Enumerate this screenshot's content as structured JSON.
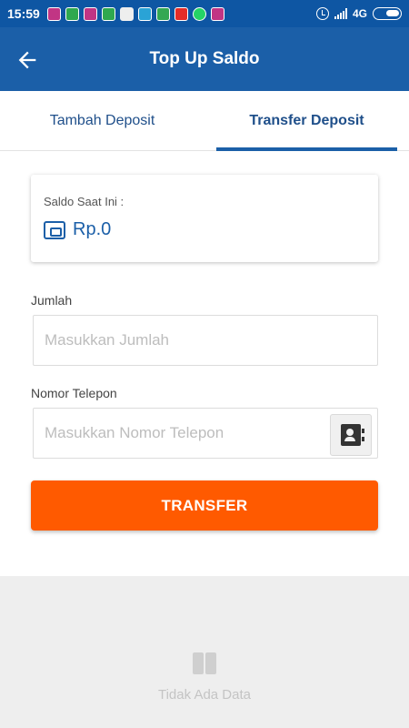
{
  "status_bar": {
    "time": "15:59",
    "network": "4G",
    "notification_icons": [
      "instagram-icon",
      "messenger-icon",
      "instagram-icon",
      "messages-icon",
      "chrome-icon",
      "telegram-icon",
      "maps-icon",
      "youtube-icon",
      "whatsapp-icon",
      "instagram-icon"
    ]
  },
  "app_bar": {
    "title": "Top Up Saldo",
    "back_icon": "arrow-left-icon"
  },
  "tabs": [
    {
      "label": "Tambah Deposit",
      "active": false
    },
    {
      "label": "Transfer Deposit",
      "active": true
    }
  ],
  "balance": {
    "label": "Saldo Saat Ini :",
    "value": "Rp.0",
    "icon": "wallet-icon"
  },
  "form": {
    "amount_label": "Jumlah",
    "amount_placeholder": "Masukkan Jumlah",
    "amount_value": "",
    "phone_label": "Nomor Telepon",
    "phone_placeholder": "Masukkan Nomor Telepon",
    "phone_value": "",
    "contact_icon": "contact-book-icon",
    "submit_label": "TRANSFER"
  },
  "empty_state": {
    "icon": "book-icon",
    "text": "Tidak Ada Data"
  },
  "colors": {
    "app_bar": "#1b5fa8",
    "status_bar": "#0e56a3",
    "accent_button": "#ff5a00",
    "empty_bg": "#eeeeee"
  }
}
